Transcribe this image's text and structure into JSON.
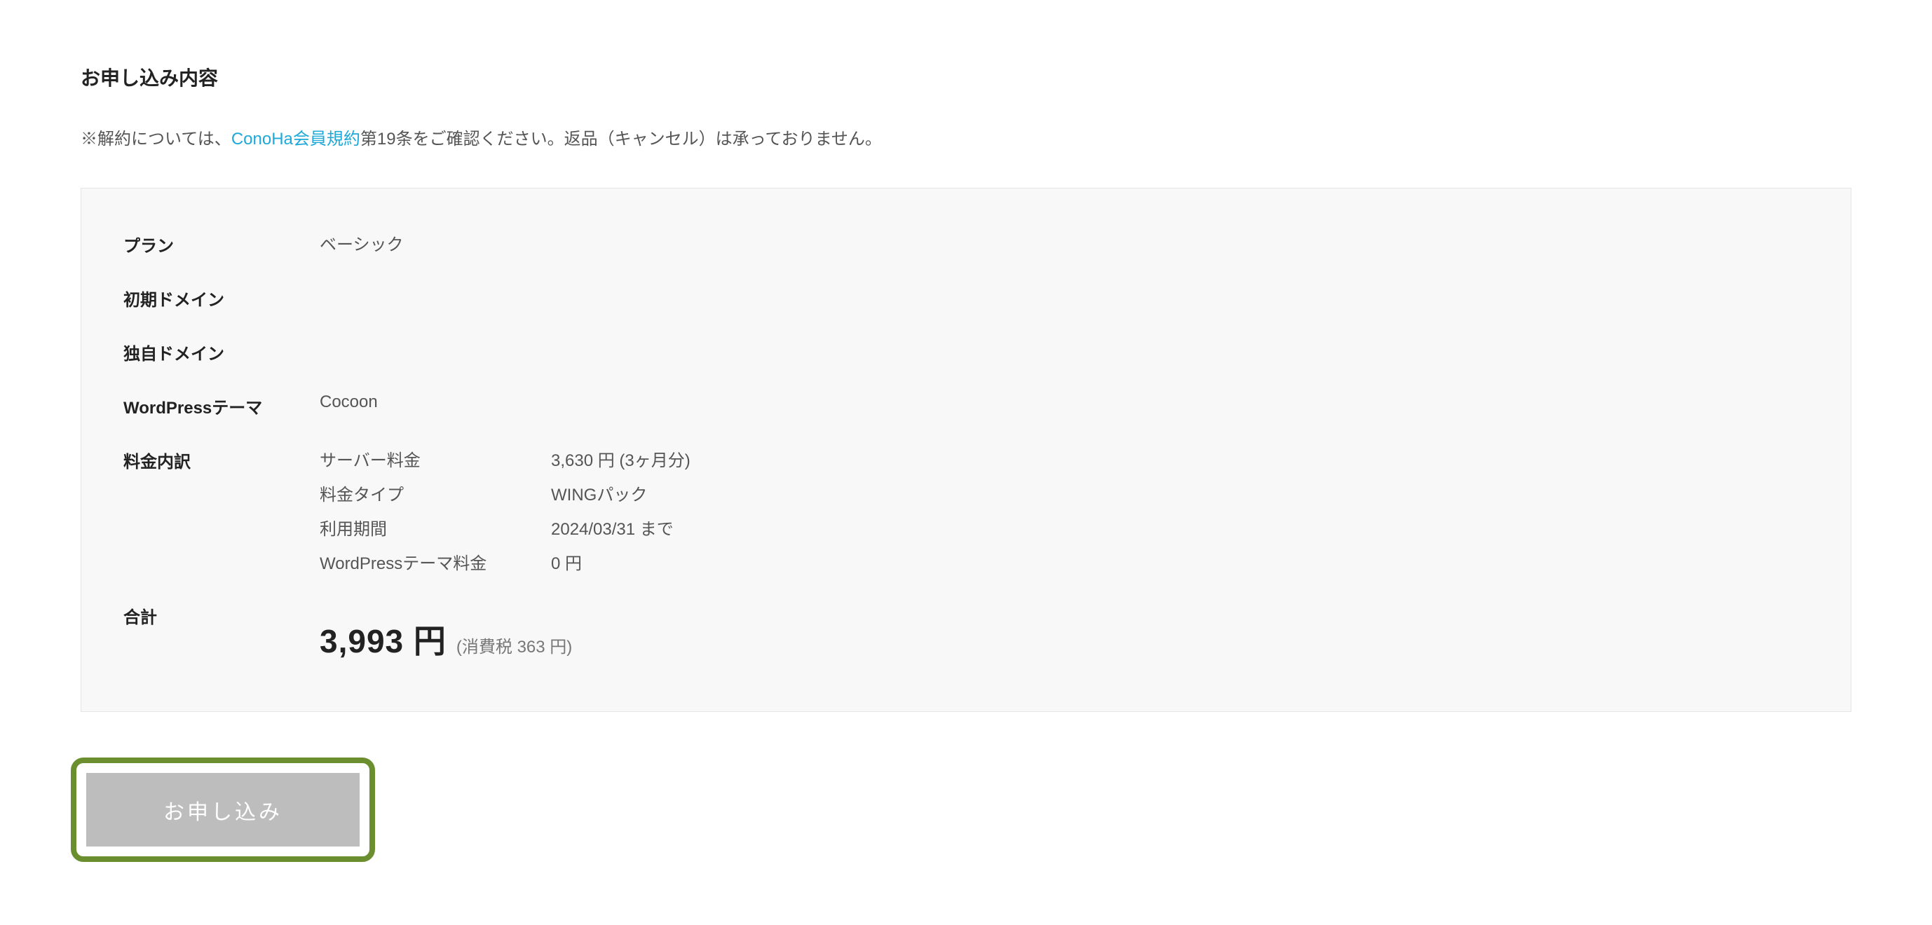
{
  "page_title": "お申し込み内容",
  "notice": {
    "prefix": "※解約については、",
    "link_text": "ConoHa会員規約",
    "suffix": "第19条をご確認ください。返品（キャンセル）は承っておりません。"
  },
  "summary": {
    "plan": {
      "label": "プラン",
      "value": "ベーシック"
    },
    "initial_domain": {
      "label": "初期ドメイン",
      "value": ""
    },
    "custom_domain": {
      "label": "独自ドメイン",
      "value": ""
    },
    "wp_theme": {
      "label": "WordPressテーマ",
      "value": "Cocoon"
    },
    "breakdown": {
      "label": "料金内訳",
      "rows": [
        {
          "name": "サーバー料金",
          "value": "3,630 円 (3ヶ月分)"
        },
        {
          "name": "料金タイプ",
          "value": "WINGパック"
        },
        {
          "name": "利用期間",
          "value": "2024/03/31 まで"
        },
        {
          "name": "WordPressテーマ料金",
          "value": "0 円"
        }
      ]
    },
    "total": {
      "label": "合計",
      "amount": "3,993 円",
      "tax_note": "(消費税 363 円)"
    }
  },
  "apply_button_label": "お申し込み",
  "colors": {
    "link": "#1fa9d8",
    "button_border": "#6b8f2f",
    "button_bg": "#bdbdbd"
  }
}
